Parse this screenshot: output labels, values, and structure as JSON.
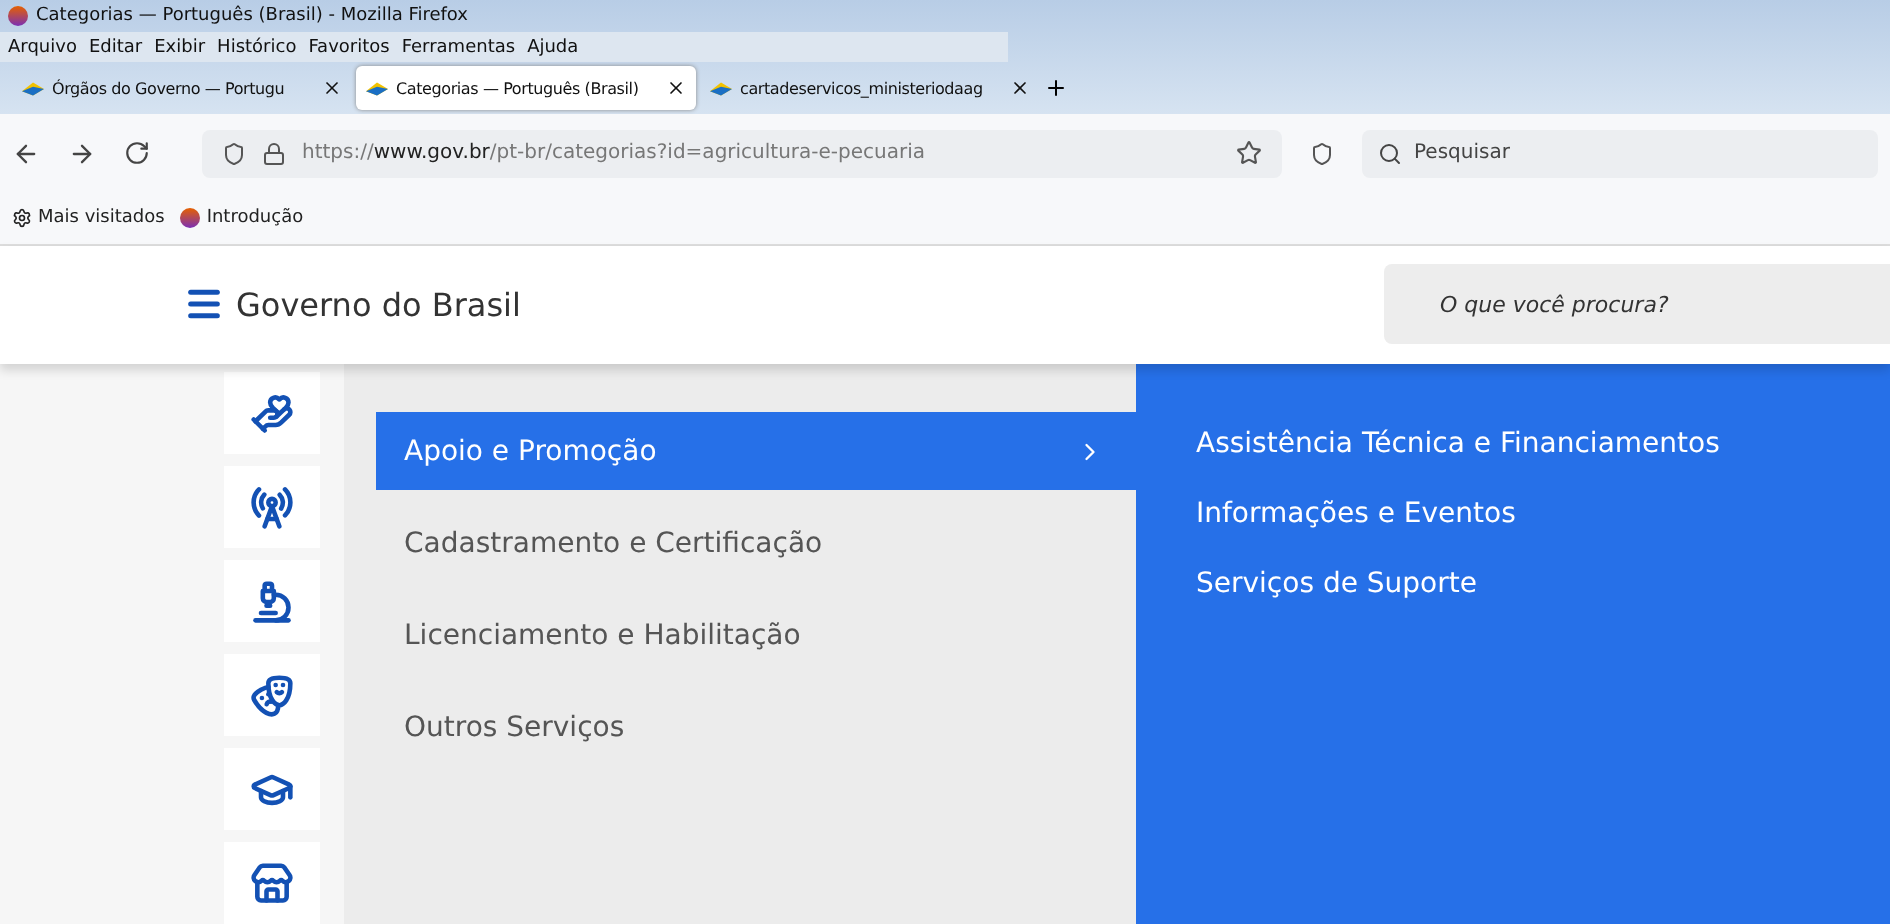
{
  "window": {
    "title": "Categorias — Português (Brasil) - Mozilla Firefox"
  },
  "menu": [
    "Arquivo",
    "Editar",
    "Exibir",
    "Histórico",
    "Favoritos",
    "Ferramentas",
    "Ajuda"
  ],
  "tabs": [
    {
      "label": "Órgãos do Governo — Portugu",
      "selected": false
    },
    {
      "label": "Categorias — Português (Brasil)",
      "selected": true
    },
    {
      "label": "cartadeservicos_ministeriodaag",
      "selected": false
    }
  ],
  "address": {
    "prefix": "https://",
    "host": "www.gov.br",
    "path": "/pt-br/categorias?id=agricultura-e-pecuaria"
  },
  "browser_search": {
    "placeholder": "Pesquisar"
  },
  "bookmarks": [
    "Mais visitados",
    "Introdução"
  ],
  "site": {
    "title": "Governo do Brasil",
    "search_placeholder": "O que você procura?"
  },
  "category_icons": [
    {
      "kind": "care"
    },
    {
      "kind": "broadcast"
    },
    {
      "kind": "science"
    },
    {
      "kind": "culture"
    },
    {
      "kind": "education"
    },
    {
      "kind": "store"
    }
  ],
  "submenu": [
    {
      "label": "Apoio e Promoção",
      "selected": true
    },
    {
      "label": "Cadastramento e Certificação",
      "selected": false
    },
    {
      "label": "Licenciamento e Habilitação",
      "selected": false
    },
    {
      "label": "Outros Serviços",
      "selected": false
    }
  ],
  "services": [
    "Assistência Técnica e Financiamentos",
    "Informações e Eventos",
    "Serviços de Suporte"
  ]
}
